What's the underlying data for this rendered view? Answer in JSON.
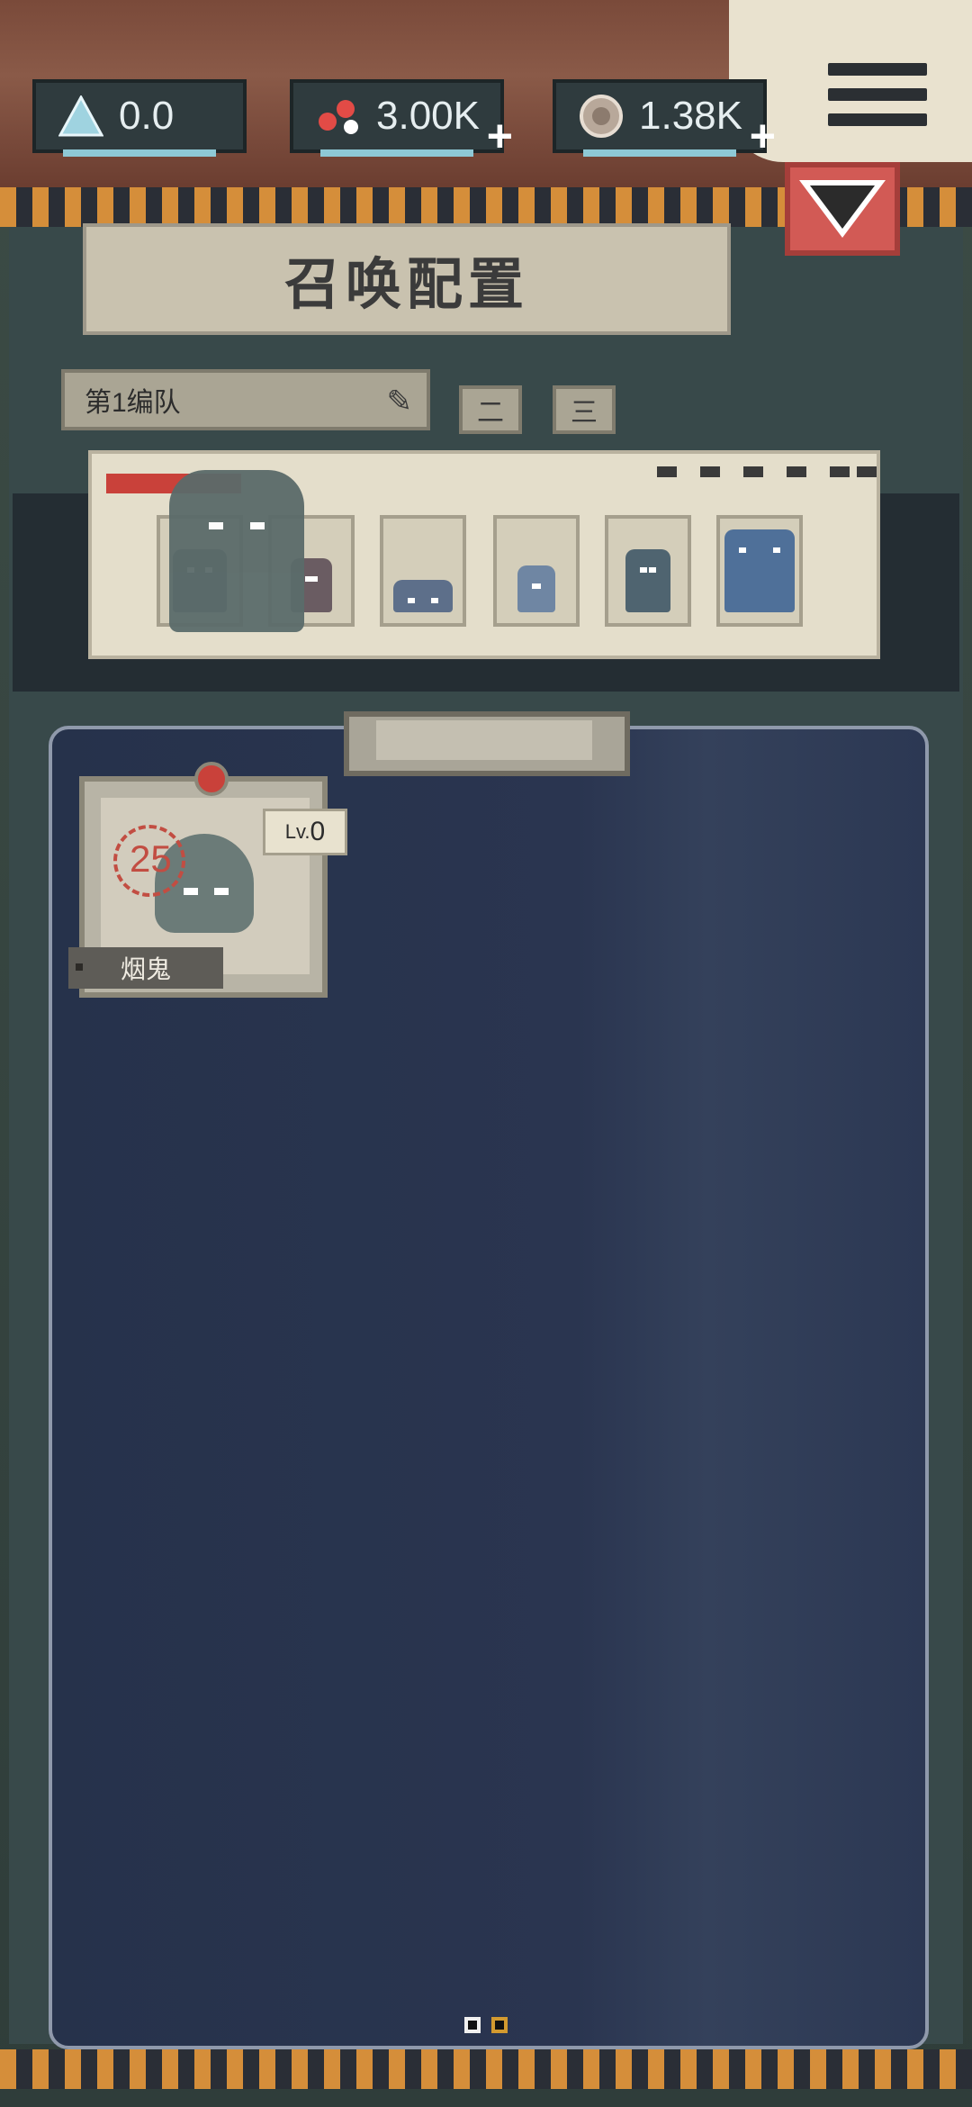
{
  "resources": [
    {
      "icon": "crystal-icon",
      "value": "0.0",
      "has_plus": false
    },
    {
      "icon": "blood-icon",
      "value": "3.00K",
      "has_plus": true
    },
    {
      "icon": "coin-icon",
      "value": "1.38K",
      "has_plus": true
    }
  ],
  "title": "召唤配置",
  "team": {
    "label": "第1编队",
    "tabs": [
      "二",
      "三"
    ]
  },
  "card": {
    "name": "烟鬼",
    "level_prefix": "Lv.",
    "level_value": "0",
    "cost": "25"
  },
  "colors": {
    "accent_red": "#d25a55",
    "panel_blue": "#26324b",
    "stripe_orange": "#d58e3a"
  }
}
